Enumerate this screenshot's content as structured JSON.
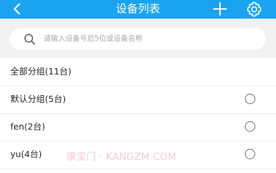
{
  "header": {
    "title": "设备列表",
    "icons": {
      "back": "chevron-left-icon",
      "add": "plus-icon",
      "settings": "gear-icon"
    },
    "color": "#1aa3f0"
  },
  "search": {
    "placeholder": "请输入设备号后5位或设备名称",
    "icon": "search-icon"
  },
  "groups": [
    {
      "label": "全部分组(11台)",
      "has_radio": false,
      "selected": false
    },
    {
      "label": "默认分组(5台)",
      "has_radio": true,
      "selected": false
    },
    {
      "label": "fen(2台)",
      "has_radio": true,
      "selected": false
    },
    {
      "label": "yu(4台)",
      "has_radio": true,
      "selected": false
    }
  ],
  "watermark": "康宝门 · KANGZM.COM"
}
